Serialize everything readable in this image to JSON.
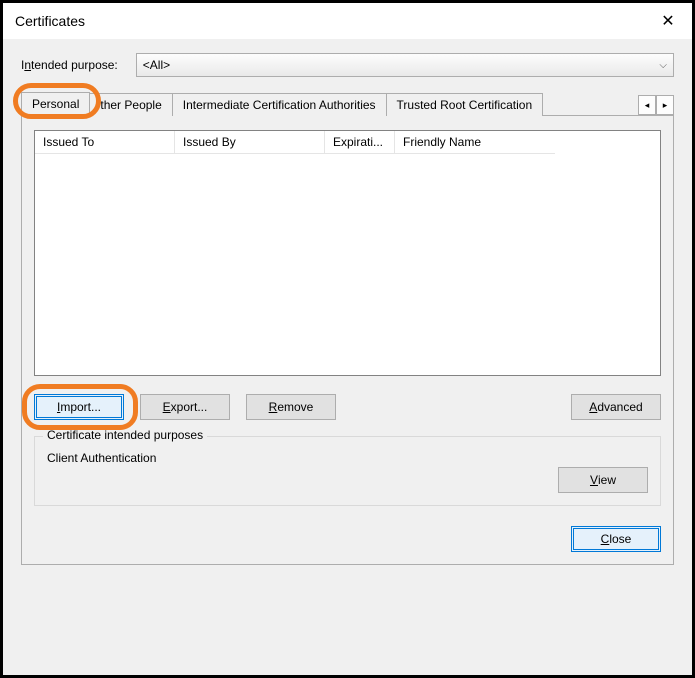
{
  "window": {
    "title": "Certificates"
  },
  "purpose": {
    "label_pre": "I",
    "label_ul": "n",
    "label_post": "tended purpose:",
    "value": "<All>"
  },
  "tabs": [
    {
      "label": "Personal",
      "active": true
    },
    {
      "label": "Other People",
      "active": false,
      "partial_prefix": "ther People"
    },
    {
      "label": "Intermediate Certification Authorities",
      "active": false
    },
    {
      "label": "Trusted Root Certification",
      "active": false
    }
  ],
  "columns": {
    "issued_to": "Issued To",
    "issued_by": "Issued By",
    "expiration": "Expirati...",
    "friendly_name": "Friendly Name"
  },
  "buttons": {
    "import_ul": "I",
    "import_post": "mport...",
    "export_ul": "E",
    "export_post": "xport...",
    "remove_ul": "R",
    "remove_post": "emove",
    "advanced_ul": "A",
    "advanced_post": "dvanced",
    "view_ul": "V",
    "view_post": "iew",
    "close_ul": "C",
    "close_post": "lose"
  },
  "group": {
    "label": "Certificate intended purposes",
    "text": "Client Authentication"
  }
}
